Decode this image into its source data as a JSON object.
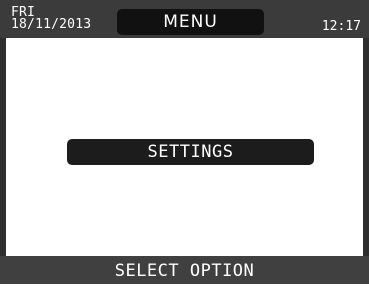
{
  "header": {
    "day": "FRI",
    "date": "18/11/2013",
    "title": "MENU",
    "time": "12:17"
  },
  "menu": {
    "options": [
      {
        "label": "SETTINGS",
        "selected": true
      }
    ]
  },
  "footer": {
    "status": "SELECT OPTION"
  },
  "colors": {
    "header_bg": "#3b3b3b",
    "pill_bg": "#111111",
    "button_bg": "#1c1c1c",
    "footer_bg": "#404040",
    "screen_bg": "#ffffff",
    "text_light": "#ffffff"
  }
}
